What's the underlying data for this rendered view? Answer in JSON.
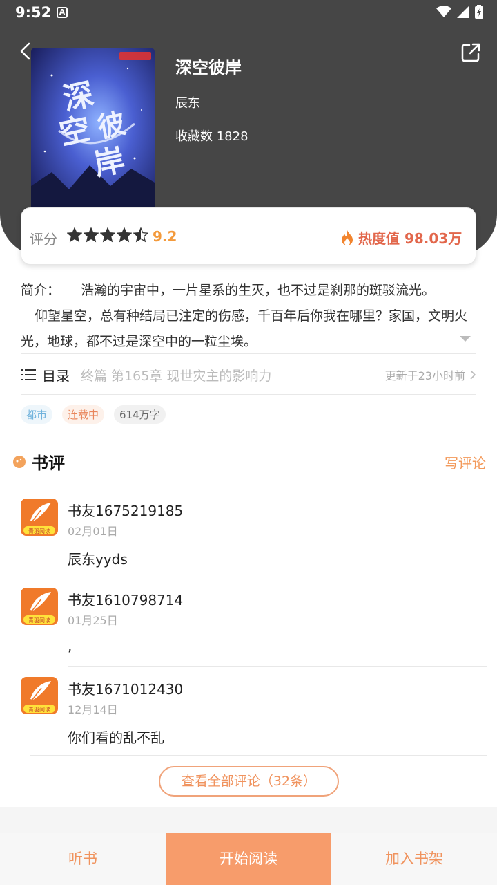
{
  "status": {
    "time": "9:52",
    "a_icon": "A"
  },
  "book": {
    "title": "深空彼岸",
    "author": "辰东",
    "favorites": "收藏数 1828"
  },
  "rating": {
    "label": "评分",
    "stars": 4.5,
    "score": "9.2",
    "heat": "热度值 98.03万"
  },
  "intro": {
    "label": "简介：",
    "line1": "浩瀚的宇宙中，一片星系的生灭，也不过是刹那的斑驳流光。",
    "line2": "仰望星空，总有种结局已注定的伤感，千百年后你我在哪里？家国，文明火光，地球，都不过是深空中的一粒尘埃。"
  },
  "toc": {
    "label": "目录",
    "chapter": "终篇 第165章 现世灾主的影响力",
    "updated": "更新于23小时前"
  },
  "tags": [
    "都市",
    "连载中",
    "614万字"
  ],
  "reviews_section": {
    "title": "书评",
    "write": "写评论",
    "view_all": "查看全部评论（32条）"
  },
  "reviews": [
    {
      "name": "书友1675219185",
      "date": "02月01日",
      "text": "辰东yyds"
    },
    {
      "name": "书友1610798714",
      "date": "01月25日",
      "text": ","
    },
    {
      "name": "书友1671012430",
      "date": "12月14日",
      "text": "你们看的乱不乱"
    }
  ],
  "bottom": {
    "listen": "听书",
    "read": "开始阅读",
    "shelf": "加入书架"
  },
  "colors": {
    "header": "#464646",
    "accent": "#f79c6b",
    "heat": "#e2674c",
    "score": "#f39a3c"
  }
}
